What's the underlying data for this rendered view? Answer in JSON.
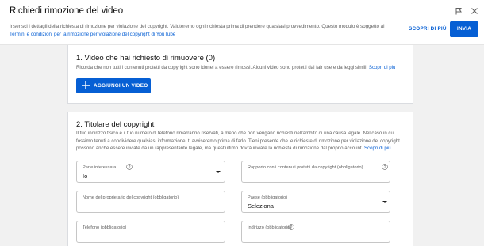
{
  "header": {
    "title": "Richiedi rimozione del video",
    "subtitle_text": "Inserisci i dettagli della richiesta di rimozione per violazione del copyright. Valuteremo ogni richiesta prima di prendere qualsiasi provvedimento. Questo modulo è soggetto ai",
    "subtitle_link": "Termini e condizioni per la rimozione per violazione del copyright di YouTube",
    "learn_more_label": "SCOPRI DI PIÙ",
    "send_label": "INVIA",
    "feedback_icon": "flag-icon",
    "close_icon": "close-icon"
  },
  "section1": {
    "title": "1. Video che hai richiesto di rimuovere (0)",
    "desc": "Ricorda che non tutti i contenuti protetti da copyright sono idonei a essere rimossi. Alcuni video sono protetti dal fair use e da leggi simili.",
    "desc_link": "Scopri di più",
    "add_button_label": "AGGIUNGI UN VIDEO",
    "add_icon": "plus-icon"
  },
  "section2": {
    "title": "2. Titolare del copyright",
    "desc": "Il tuo indirizzo fisico e il tuo numero di telefono rimarranno riservati, a meno che non vengano richiesti nell'ambito di una causa legale. Nel caso in cui fossimo tenuti a condividere qualsiasi informazione, ti avviseremo prima di farlo. Tieni presente che le richieste di rimozione per violazione del copyright possono anche essere inviate da un rappresentante legale, ma quest'ultimo dovrà inviare la richiesta di rimozione dal proprio account.",
    "desc_link": "Scopri di più",
    "fields": {
      "interested_party": {
        "label": "Parte interessata",
        "value": "Io"
      },
      "relationship": {
        "label": "Rapporto con i contenuti protetti da copyright (obbligatorio)",
        "value": ""
      },
      "owner_name": {
        "label": "Nome del proprietario del copyright (obbligatorio)",
        "value": ""
      },
      "country": {
        "label": "Paese (obbligatorio)",
        "value": "Seleziona"
      },
      "phone": {
        "label": "Telefono (obbligatorio)",
        "value": ""
      },
      "address": {
        "label": "Indirizzo (obbligatorio)",
        "value": ""
      }
    }
  },
  "colors": {
    "accent": "#065fd4",
    "background": "#f1f1f1"
  }
}
